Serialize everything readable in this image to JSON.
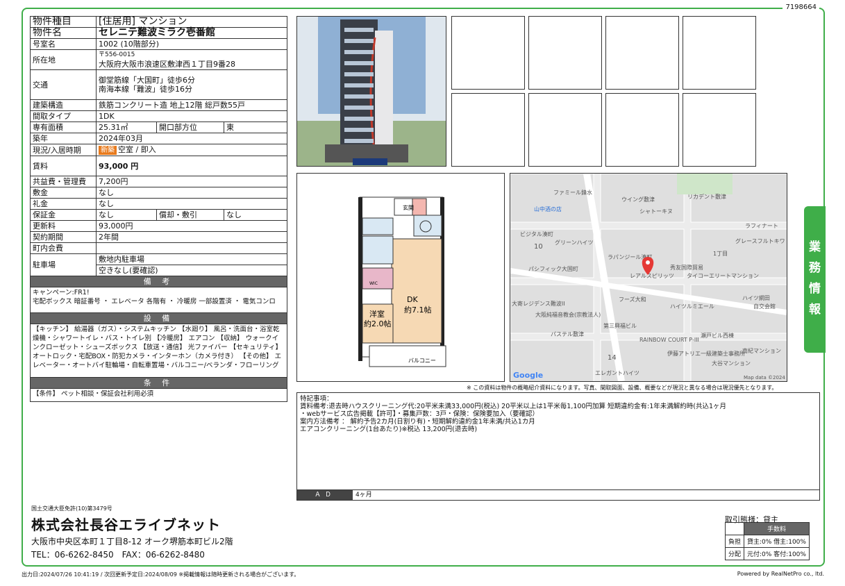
{
  "doc_id": "7198664",
  "property": {
    "type_label": "物件種目",
    "type_value": "[住居用] マンション",
    "name_label": "物件名",
    "name_value": "セレニテ難波ミラク壱番館",
    "room_label": "号室名",
    "room_value": "1002 (10階部分)",
    "address_label": "所在地",
    "postal": "〒556-0015",
    "address": "大阪府大阪市浪速区敷津西１丁目9番28",
    "transport_label": "交通",
    "transport_1": "御堂筋線「大国町」徒歩6分",
    "transport_2": "南海本線「難波」徒歩16分",
    "structure_label": "建築構造",
    "structure_value": "鉄筋コンクリート造 地上12階 総戸数55戸",
    "layout_label": "間取タイプ",
    "layout_value": "1DK",
    "area_label": "専有面積",
    "area_value": "25.31㎡",
    "direction_label": "開口部方位",
    "direction_value": "東",
    "built_label": "築年",
    "built_value": "2024年03月",
    "status_label": "現況/入居時期",
    "status_badge": "新築",
    "status_value": "空室 / 即入",
    "rent_label": "賃料",
    "rent_value": "93,000 円",
    "fee_label": "共益費・管理費",
    "fee_value": "7,200円",
    "deposit_label": "敷金",
    "deposit_value": "なし",
    "key_label": "礼金",
    "key_value": "なし",
    "guarantee_label": "保証金",
    "guarantee_value": "なし",
    "amort_label": "償却・敷引",
    "amort_value": "なし",
    "renew_label": "更新料",
    "renew_value": "93,000円",
    "contract_label": "契約期間",
    "contract_value": "2年間",
    "assoc_label": "町内会費",
    "assoc_value": "",
    "parking_label": "駐車場",
    "parking_1": "敷地内駐車場",
    "parking_2": "空きなし(要確認)"
  },
  "sections": {
    "remarks_head": "備 考",
    "remarks_text": "キャンペーン:FR1!\n宅配ボックス 暗証番号 ・ エレベータ 各階有 ・ 冷暖房 一部設置済 ・ 電気コンロ",
    "equipment_head": "設 備",
    "equipment_text": "【キッチン】 給湯器（ガス）・システムキッチン 【水廻り】 風呂・洗面台・浴室乾燥機・シャワートイレ・バス・トイレ別 【冷暖房】 エアコン 【収納】 ウォークインクローゼット・シューズボックス 【放送・通信】 光ファイバー 【セキュリティ】 オートロック・宅配BOX・防犯カメラ・インターホン（カメラ付き） 【その他】 エレベーター・オートバイ駐輪場・自転車置場・バルコニー/ベランダ・フローリング",
    "conditions_head": "条 件",
    "conditions_text": "【条件】 ペット相談・保証会社利用必須"
  },
  "floorplan": {
    "dk_label": "DK",
    "dk_size": "約7.1帖",
    "western_label": "洋室",
    "western_size": "約2.0帖",
    "entrance": "玄関",
    "balcony": "バルコニー",
    "wic": "WIC"
  },
  "map": {
    "labels": [
      "ファミール鋒水",
      "ウイング敷津",
      "リカデント敷津",
      "山中酒の店",
      "シャトーキヌ",
      "ラフィナート",
      "ビジタル湊町",
      "グリーンハイツ",
      "グレースフルトキワ",
      "ラパンジール湊町",
      "1丁目",
      "パシフィック大国町",
      "秀友国際貿易",
      "レアルスピリッツ",
      "タイコーエリートマンション",
      "フーズ大和",
      "ハイツ網田",
      "大寄レジデンス難波II",
      "ハイツルミエール",
      "自交会館",
      "大阪純福音教会(宗教法人)",
      "第三興福ビル",
      "瀬戸ビル西棟",
      "パステル敷津",
      "RAINBOW COURT P-III",
      "南紀マンション",
      "伊藤アトリエ一級建築士事務所",
      "大谷マンション",
      "エレガントハイツ",
      "Google",
      "Map data ©2024",
      "10",
      "14"
    ]
  },
  "side_tab": "業務情報",
  "disclaimer": "※ この資料は物件の概略紹介資料になります。写真、間取図面、設備、概要などが現況と異なる場合は現況優先となります。",
  "notes": {
    "text": "特記事項：\n賃料備考:退去時ハウスクリーニング代:20平米未満33,000円(税込) 20平米以上は1平米毎1,100円加算 短期違約金有:1年未満解約時(共込1ヶ月\n・webサービス広告掲載【許可】・募集戸数：3戸・保険：保険要加入（要確認）\n案内方法備考 ： 解約予告2カ月(日割り有)・短期解約違約金1年未満/共込1カ月\nエアコンクリーニング(1台あたり)※税込 13,200円(退去時)",
    "ad_label": "ＡＤ",
    "ad_value": "4ヶ月"
  },
  "company": {
    "license": "国土交通大臣免許(10)第3479号",
    "name": "株式会社長谷エライブネット",
    "address": "大阪市中央区本町１丁目8-12 オーク堺筋本町ビル2階",
    "phone": "TEL：06-6262-8450　FAX：06-6262-8480"
  },
  "transaction": {
    "mode": "取引態様：貸主",
    "fee_head": "手数料",
    "burden_label": "負担",
    "burden_value": "貸主:0% 借主:100%",
    "split_label": "分配",
    "split_value": "元付:0% 客付:100%"
  },
  "footer": {
    "left": "出力日:2024/07/26 10:41:19 / 次回更新予定日:2024/08/09 ※掲載情報は随時更新される場合がございます。",
    "right": "Powered by RealNetPro co., ltd."
  }
}
